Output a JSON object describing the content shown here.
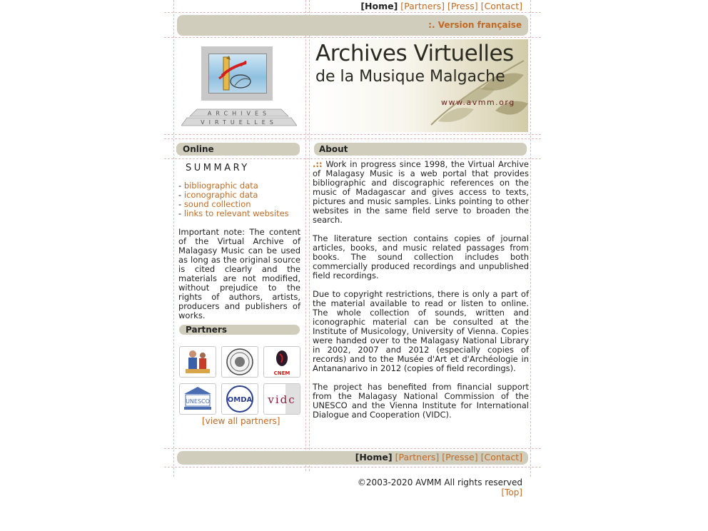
{
  "top_nav": {
    "home": "[Home]",
    "partners": "[Partners]",
    "press": "[Press]",
    "contact": "[Contact]"
  },
  "lang_link": ":. Version française",
  "banner": {
    "line1": "Archives Virtuelles",
    "line2": "de la Musique Malgache",
    "url": "www.avmm.org"
  },
  "logo_text": [
    "ARCHIVES",
    "VIRTUELLES"
  ],
  "online": {
    "heading": "Online",
    "summary_title": "SUMMARY",
    "links": [
      {
        "prefix": "- ",
        "label": "bibliographic data"
      },
      {
        "prefix": "- ",
        "label": "iconographic data"
      },
      {
        "prefix": "- ",
        "label": "sound collection"
      },
      {
        "prefix": "- ",
        "label": "links to relevant websites"
      }
    ],
    "note": "Important note: The content of the Virtual Archive of Malagasy Music can be used as long as the original source is cited clearly and the materials are not modified, without prejudice to the rights of authors, artists, producers and publishers of works."
  },
  "partners": {
    "heading": "Partners",
    "tiles": [
      {
        "icon": "musicians-icon"
      },
      {
        "icon": "university-seal-icon"
      },
      {
        "icon": "cnem-icon",
        "caption": "CNEM"
      },
      {
        "icon": "unesco-icon",
        "caption": "UNESCO"
      },
      {
        "icon": "omda-icon",
        "caption": "OMDA"
      },
      {
        "icon": "vidc-icon",
        "caption": "vidc"
      }
    ],
    "view_all": "[view all partners]"
  },
  "about": {
    "heading": "About",
    "marker": ".::",
    "paragraphs": [
      " Work in progress since 1998, the Virtual Archive of Malagasy Music is a web portal that provides bibliographic and discographic references on the music of Madagascar and gives access to texts, pictures and music samples. Links pointing to other websites in the same field serve to broaden the search.",
      "The literature section contains copies of journal articles, books, and music related passages from books. The sound collection includes both commercially produced recordings and unpublished field recordings.",
      "Due to copyright restrictions, there is only a part of the material available to read or listen to online. The whole collection of sounds, written and iconographic material can be consulted at the Institute of Musicology, University of Vienna. Copies were handed over to the Malagasy National Library in 2002, 2007 and 2012 (especially copies of records) and to the Musée d'Art et d'Archéologie in Antananarivo in 2012 (copies of field recordings).",
      "The project has benefited from financial support from the Malagasy National Commission of the UNESCO and the Vienna Institute for International Dialogue and Cooperation (VIDC)."
    ]
  },
  "bottom_nav": {
    "home": "[Home]",
    "partners": "[Partners]",
    "press": "[Presse]",
    "contact": "[Contact]"
  },
  "footer": {
    "copyright": "©2003-2020 AVMM All rights reserved ",
    "top": "[Top]"
  },
  "colors": {
    "link": "#c06a25",
    "bar": "#d1cdbd",
    "guide": "#e3b9b9"
  }
}
